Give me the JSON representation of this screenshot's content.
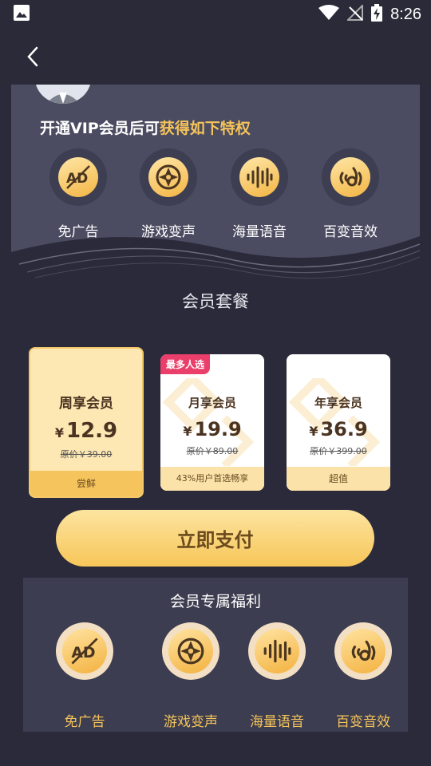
{
  "status_bar": {
    "time": "8:26"
  },
  "privileges": {
    "title_prefix": "开通VIP会员后可",
    "title_highlight": "获得如下特权",
    "items": [
      {
        "label": "免广告",
        "icon": "no-ad-icon"
      },
      {
        "label": "游戏变声",
        "icon": "gamepad-icon"
      },
      {
        "label": "海量语音",
        "icon": "sound-wave-icon"
      },
      {
        "label": "百变音效",
        "icon": "sound-effect-icon"
      }
    ]
  },
  "plans": {
    "section_title": "会员套餐",
    "currency": "¥",
    "items": [
      {
        "name": "周享会员",
        "price": "12.9",
        "original": "原价￥39.00",
        "footer": "尝鲜",
        "selected": true
      },
      {
        "name": "月享会员",
        "price": "19.9",
        "original": "原价￥89.00",
        "footer": "43%用户首选畅享",
        "badge": "最多人选"
      },
      {
        "name": "年享会员",
        "price": "36.9",
        "original": "原价￥399.00",
        "footer": "超值"
      }
    ]
  },
  "pay_button": "立即支付",
  "benefits": {
    "title": "会员专属福利",
    "items": [
      {
        "label": "免广告",
        "icon": "no-ad-icon"
      },
      {
        "label": "游戏变声",
        "icon": "gamepad-icon"
      },
      {
        "label": "海量语音",
        "icon": "sound-wave-icon"
      },
      {
        "label": "百变音效",
        "icon": "sound-effect-icon"
      }
    ]
  },
  "colors": {
    "accent": "#f5c35a",
    "background": "#2a2a3a",
    "panel": "#4b4c61",
    "badge": "#ea3f6b"
  }
}
